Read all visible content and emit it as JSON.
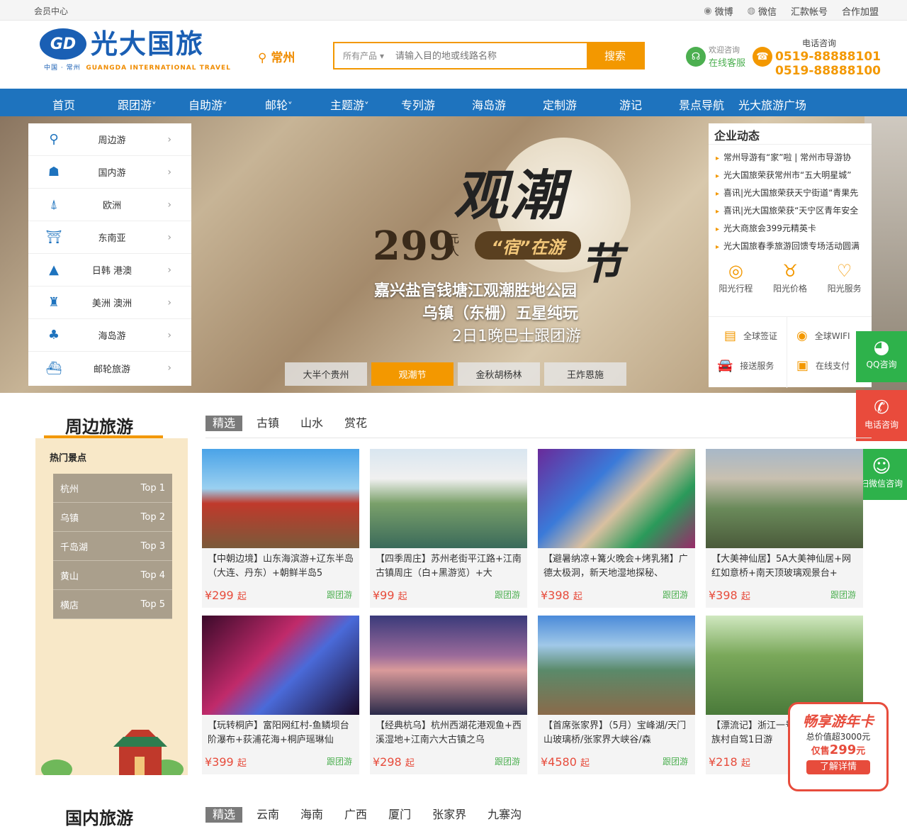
{
  "topbar": {
    "member": "会员中心",
    "links": [
      "微博",
      "微信",
      "汇款帐号",
      "合作加盟"
    ]
  },
  "header": {
    "brand": "光大国旅",
    "logo_mark": "GD",
    "logo_sub_cn": "中国 · 常州",
    "logo_sub_en": "GUANGDA INTERNATIONAL TRAVEL",
    "city": "常州",
    "search": {
      "category": "所有产品",
      "placeholder": "请输入目的地或线路名称",
      "button": "搜索"
    },
    "consult": {
      "line1": "欢迎咨询",
      "line2": "在线客服"
    },
    "phone": {
      "label": "电话咨询",
      "num1": "0519-88888101",
      "num2": "0519-88888100"
    }
  },
  "nav": [
    {
      "label": "首页",
      "caret": ""
    },
    {
      "label": "跟团游",
      "caret": "˅"
    },
    {
      "label": "自助游",
      "caret": "˅"
    },
    {
      "label": "邮轮",
      "caret": "˅"
    },
    {
      "label": "主题游",
      "caret": "˅"
    },
    {
      "label": "专列游",
      "caret": ""
    },
    {
      "label": "海岛游",
      "caret": ""
    },
    {
      "label": "定制游",
      "caret": ""
    },
    {
      "label": "游记",
      "caret": ""
    },
    {
      "label": "景点导航",
      "caret": ""
    },
    {
      "label": "光大旅游广场",
      "caret": ""
    }
  ],
  "sidemenu": [
    {
      "label": "周边游",
      "icon": "map-pin-icon"
    },
    {
      "label": "国内游",
      "icon": "china-map-icon"
    },
    {
      "label": "欧洲",
      "icon": "eiffel-tower-icon"
    },
    {
      "label": "东南亚",
      "icon": "temple-icon"
    },
    {
      "label": "日韩 港澳",
      "icon": "mountain-icon"
    },
    {
      "label": "美洲 澳洲",
      "icon": "statue-of-liberty-icon"
    },
    {
      "label": "海岛游",
      "icon": "palm-tree-icon"
    },
    {
      "label": "邮轮旅游",
      "icon": "cruise-ship-icon"
    }
  ],
  "banner": {
    "title": "观潮",
    "title_end": "节",
    "price": "299",
    "unit1": "元",
    "unit2": "人",
    "tag": "“宿”在游",
    "line1": "嘉兴盐官钱塘江观潮胜地公园",
    "line2": "乌镇（东栅）五星纯玩",
    "line3": "2日1晚巴士跟团游",
    "tabs": [
      "大半个贵州",
      "观潮节",
      "金秋胡杨林",
      "王炸恩施"
    ],
    "active_tab": 1
  },
  "news": {
    "title": "企业动态",
    "items": [
      "常州导游有“家”啦 | 常州市导游协",
      "光大国旅荣获常州市“五大明星城”",
      "喜讯|光大国旅荣获天宁街道“青果先",
      "喜讯|光大国旅荣获“天宁区青年安全",
      "光大商旅会399元精英卡",
      "光大国旅春季旅游回馈专场活动圆满"
    ],
    "features": [
      "阳光行程",
      "阳光价格",
      "阳光服务"
    ],
    "services": [
      "全球签证",
      "全球WIFI",
      "接送服务",
      "在线支付"
    ]
  },
  "float": {
    "qq": "QQ咨询",
    "phone": "电话咨询",
    "wechat": "扫微信咨询"
  },
  "section1": {
    "title": "周边旅游",
    "tabs": [
      "精选",
      "古镇",
      "山水",
      "赏花"
    ],
    "hot_title": "热门景点",
    "hot": [
      {
        "name": "杭州",
        "rank": "Top 1"
      },
      {
        "name": "乌镇",
        "rank": "Top 2"
      },
      {
        "name": "千岛湖",
        "rank": "Top 3"
      },
      {
        "name": "黄山",
        "rank": "Top 4"
      },
      {
        "name": "横店",
        "rank": "Top 5"
      }
    ],
    "cards": [
      {
        "title": "【中朝边境】山东海滨游+辽东半岛（大连、丹东）+朝鲜半岛5",
        "price": "¥299",
        "suffix": "起",
        "type": "跟团游",
        "img": "linear-gradient(180deg,#4aa3e8 0%,#9ad0f0 40%,#c0392b 55%,#7a5a3a 100%)"
      },
      {
        "title": "【四季周庄】苏州老街平江路+江南古镇周庄（白+黑游览）+大",
        "price": "¥99",
        "suffix": "起",
        "type": "跟团游",
        "img": "linear-gradient(180deg,#d9e6f0 0%,#f0f0f0 30%,#7aa06a 55%,#3a6a5a 100%)"
      },
      {
        "title": "【避暑纳凉+篝火晚会+烤乳猪】广德太极洞，新天地湿地探秘、",
        "price": "¥398",
        "suffix": "起",
        "type": "跟团游",
        "img": "linear-gradient(135deg,#6a2a9a 0%,#3a7ad9 35%,#d9c0a0 55%,#2a9a5a 75%,#9a2a6a 100%)"
      },
      {
        "title": "【大美神仙居】5A大美神仙居+网红如意桥+南天顶玻璃观景台+",
        "price": "¥398",
        "suffix": "起",
        "type": "跟团游",
        "img": "linear-gradient(180deg,#a8b8c8 0%,#c8c0b0 30%,#6a8a5a 60%,#4a5a3a 100%)"
      },
      {
        "title": "【玩转桐庐】富阳网红村-鱼鳞坝台阶瀑布+荻浦花海+桐庐瑶琳仙",
        "price": "¥399",
        "suffix": "起",
        "type": "跟团游",
        "img": "linear-gradient(135deg,#3a0a2a 0%,#c02a6a 40%,#4a6ad9 60%,#1a0a2a 100%)"
      },
      {
        "title": "【经典杭乌】杭州西湖花港观鱼+西溪湿地+江南六大古镇之乌",
        "price": "¥298",
        "suffix": "起",
        "type": "跟团游",
        "img": "linear-gradient(180deg,#3a3a7a 0%,#9a6a9a 40%,#d99a9a 55%,#2a2a4a 100%)"
      },
      {
        "title": "【首席张家界】（5月）宝峰湖/天门山玻璃桥/张家界大峡谷/森",
        "price": "¥4580",
        "suffix": "起",
        "type": "跟团游",
        "img": "linear-gradient(180deg,#4a8ad9 0%,#a0c8e8 30%,#5a8a6a 55%,#8a6a4a 100%)"
      },
      {
        "title": "【漂流记】浙江一号公路+临安情畲族村自驾1日游",
        "price": "¥218",
        "suffix": "起",
        "type": "跟团游",
        "img": "linear-gradient(180deg,#d0e8c0 0%,#7aa85a 40%,#4a7a3a 100%)"
      }
    ]
  },
  "section2": {
    "title": "国内旅游",
    "tabs": [
      "精选",
      "云南",
      "海南",
      "广西",
      "厦门",
      "张家界",
      "九寨沟"
    ]
  },
  "promo": {
    "title": "畅享游年卡",
    "line1": "总价值超3000元",
    "line2_pre": "仅售",
    "line2_num": "299",
    "line2_suf": "元",
    "button": "了解详情"
  }
}
